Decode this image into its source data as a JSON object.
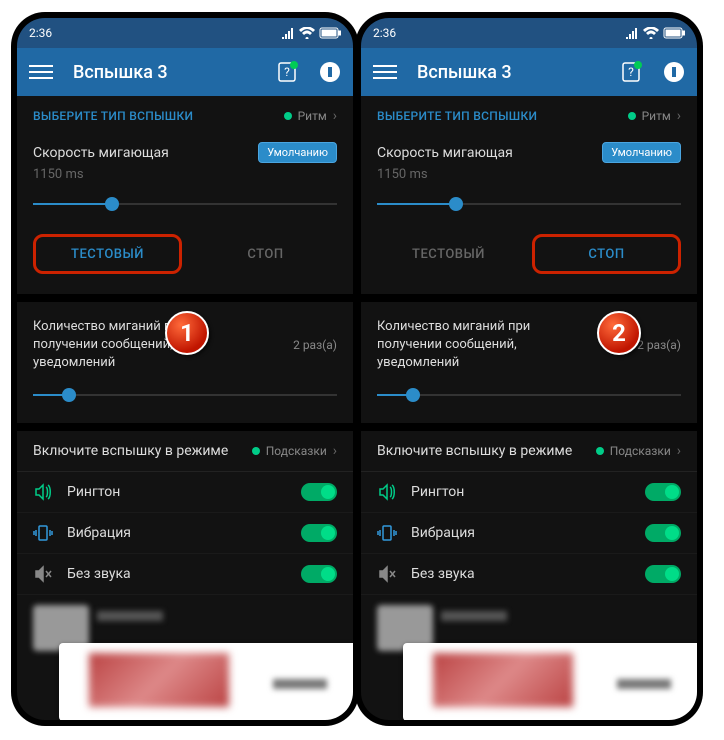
{
  "status": {
    "time": "2:36"
  },
  "header": {
    "title": "Вспышка 3"
  },
  "flash": {
    "section_title": "ВЫБЕРИТЕ ТИП ВСПЫШКИ",
    "type": "Ритм",
    "speed_label": "Скорость мигающая",
    "default_btn": "Умолчанию",
    "speed_ms": "1150 ms",
    "test_btn": "ТЕСТОВЫЙ",
    "stop_btn": "СТОП"
  },
  "blinks": {
    "label": "Количество миганий при получении сообщений, уведомлений",
    "value": "2 раз(а)"
  },
  "mode": {
    "label": "Включите вспышку в режиме",
    "value": "Подсказки"
  },
  "sounds": {
    "ringtone": "Рингтон",
    "vibration": "Вибрация",
    "silent": "Без звука"
  },
  "markers": {
    "one": "1",
    "two": "2"
  }
}
